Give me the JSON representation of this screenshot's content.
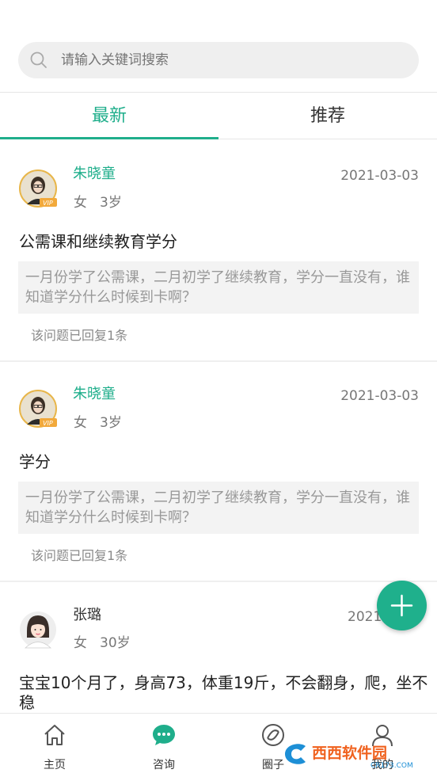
{
  "search": {
    "placeholder": "请输入关键词搜索"
  },
  "tabs": [
    {
      "label": "最新"
    },
    {
      "label": "推荐"
    }
  ],
  "posts": [
    {
      "author": "朱晓童",
      "gender": "女",
      "age": "3岁",
      "date": "2021-03-03",
      "title": "公需课和继续教育学分",
      "content": "一月份学了公需课，二月初学了继续教育，学分一直没有，谁知道学分什么时候到卡啊？",
      "replies": "该问题已回复1条",
      "vip": "VIP"
    },
    {
      "author": "朱晓童",
      "gender": "女",
      "age": "3岁",
      "date": "2021-03-03",
      "title": "学分",
      "content": "一月份学了公需课，二月初学了继续教育，学分一直没有，谁知道学分什么时候到卡啊？",
      "replies": "该问题已回复1条",
      "vip": "VIP"
    },
    {
      "author": "张璐",
      "gender": "女",
      "age": "30岁",
      "date": "2021-",
      "title": "宝宝10个月了，身高73，体重19斤，不会翻身，爬，坐不",
      "title2": "稳"
    }
  ],
  "tabbar": [
    {
      "label": "主页",
      "icon": "home-icon"
    },
    {
      "label": "咨询",
      "icon": "chat-icon"
    },
    {
      "label": "圈子",
      "icon": "circle-icon"
    },
    {
      "label": "我的",
      "icon": "user-icon"
    }
  ],
  "watermark": {
    "text": "西西软件园",
    "sub": "CR173.COM"
  },
  "colors": {
    "accent": "#1fae8b",
    "fab": "#1fb08c"
  }
}
